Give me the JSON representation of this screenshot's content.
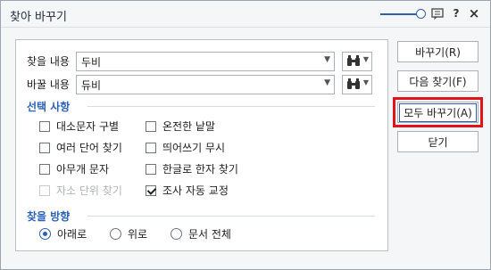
{
  "window": {
    "title": "찾아 바꾸기"
  },
  "titlebar_icons": {
    "help": "?",
    "close": "×"
  },
  "find": {
    "label": "찾을 내용",
    "value": "두비"
  },
  "replace": {
    "label": "바꿀 내용",
    "value": "듀비"
  },
  "options": {
    "title": "선택 사항",
    "items": [
      {
        "label": "대소문자 구별",
        "checked": false,
        "enabled": true
      },
      {
        "label": "온전한 낱말",
        "checked": false,
        "enabled": true
      },
      {
        "label": "여러 단어 찾기",
        "checked": false,
        "enabled": true
      },
      {
        "label": "띄어쓰기 무시",
        "checked": false,
        "enabled": true
      },
      {
        "label": "아무개 문자",
        "checked": false,
        "enabled": true
      },
      {
        "label": "한글로 한자 찾기",
        "checked": false,
        "enabled": true
      },
      {
        "label": "자소 단위 찾기",
        "checked": false,
        "enabled": false
      },
      {
        "label": "조사 자동 교정",
        "checked": true,
        "enabled": true
      }
    ]
  },
  "direction": {
    "title": "찾을 방향",
    "items": [
      {
        "label": "아래로",
        "selected": true
      },
      {
        "label": "위로",
        "selected": false
      },
      {
        "label": "문서 전체",
        "selected": false
      }
    ]
  },
  "buttons": {
    "replace": "바꾸기(R)",
    "find_next": "다음 찾기(F)",
    "replace_all": "모두 바꾸기(A)",
    "close": "닫기"
  },
  "colors": {
    "accent": "#2b62b8",
    "highlight": "#e0141a"
  }
}
